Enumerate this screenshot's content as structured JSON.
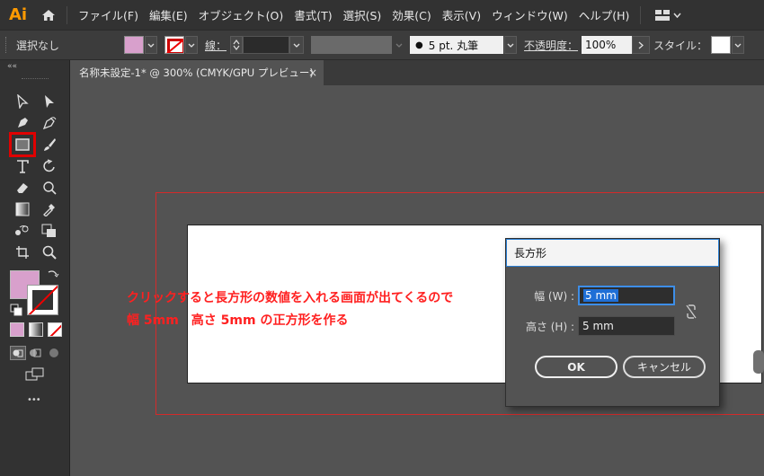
{
  "app": {
    "logo_text": "Ai"
  },
  "menu": {
    "items": [
      "ファイル(F)",
      "編集(E)",
      "オブジェクト(O)",
      "書式(T)",
      "選択(S)",
      "効果(C)",
      "表示(V)",
      "ウィンドウ(W)",
      "ヘルプ(H)"
    ]
  },
  "control_bar": {
    "selection_label": "選択なし",
    "stroke_label": "線：",
    "brush_label": "5 pt. 丸筆",
    "opacity_label": "不透明度：",
    "opacity_value": "100%",
    "style_label": "スタイル："
  },
  "colors": {
    "fill": "#d8a0cc",
    "accent": "#ff9a00",
    "highlight_box": "#e00000",
    "annotation": "#ff2020"
  },
  "document": {
    "tab_title": "名称未設定-1* @ 300% (CMYK/GPU プレビュー)",
    "close_glyph": "×"
  },
  "annotation": {
    "line1": "クリックすると長方形の数値を入れる画面が出てくるので",
    "line2": "幅 5mm　高さ 5mm の正方形を作る"
  },
  "dialog": {
    "title": "長方形",
    "width_label": "幅 (W) :",
    "width_value": "5 mm",
    "height_label": "高さ (H) :",
    "height_value": "5 mm",
    "ok_label": "OK",
    "cancel_label": "キャンセル"
  },
  "toolbar": {
    "collapse_glyph": "««",
    "more_glyph": "•••"
  }
}
